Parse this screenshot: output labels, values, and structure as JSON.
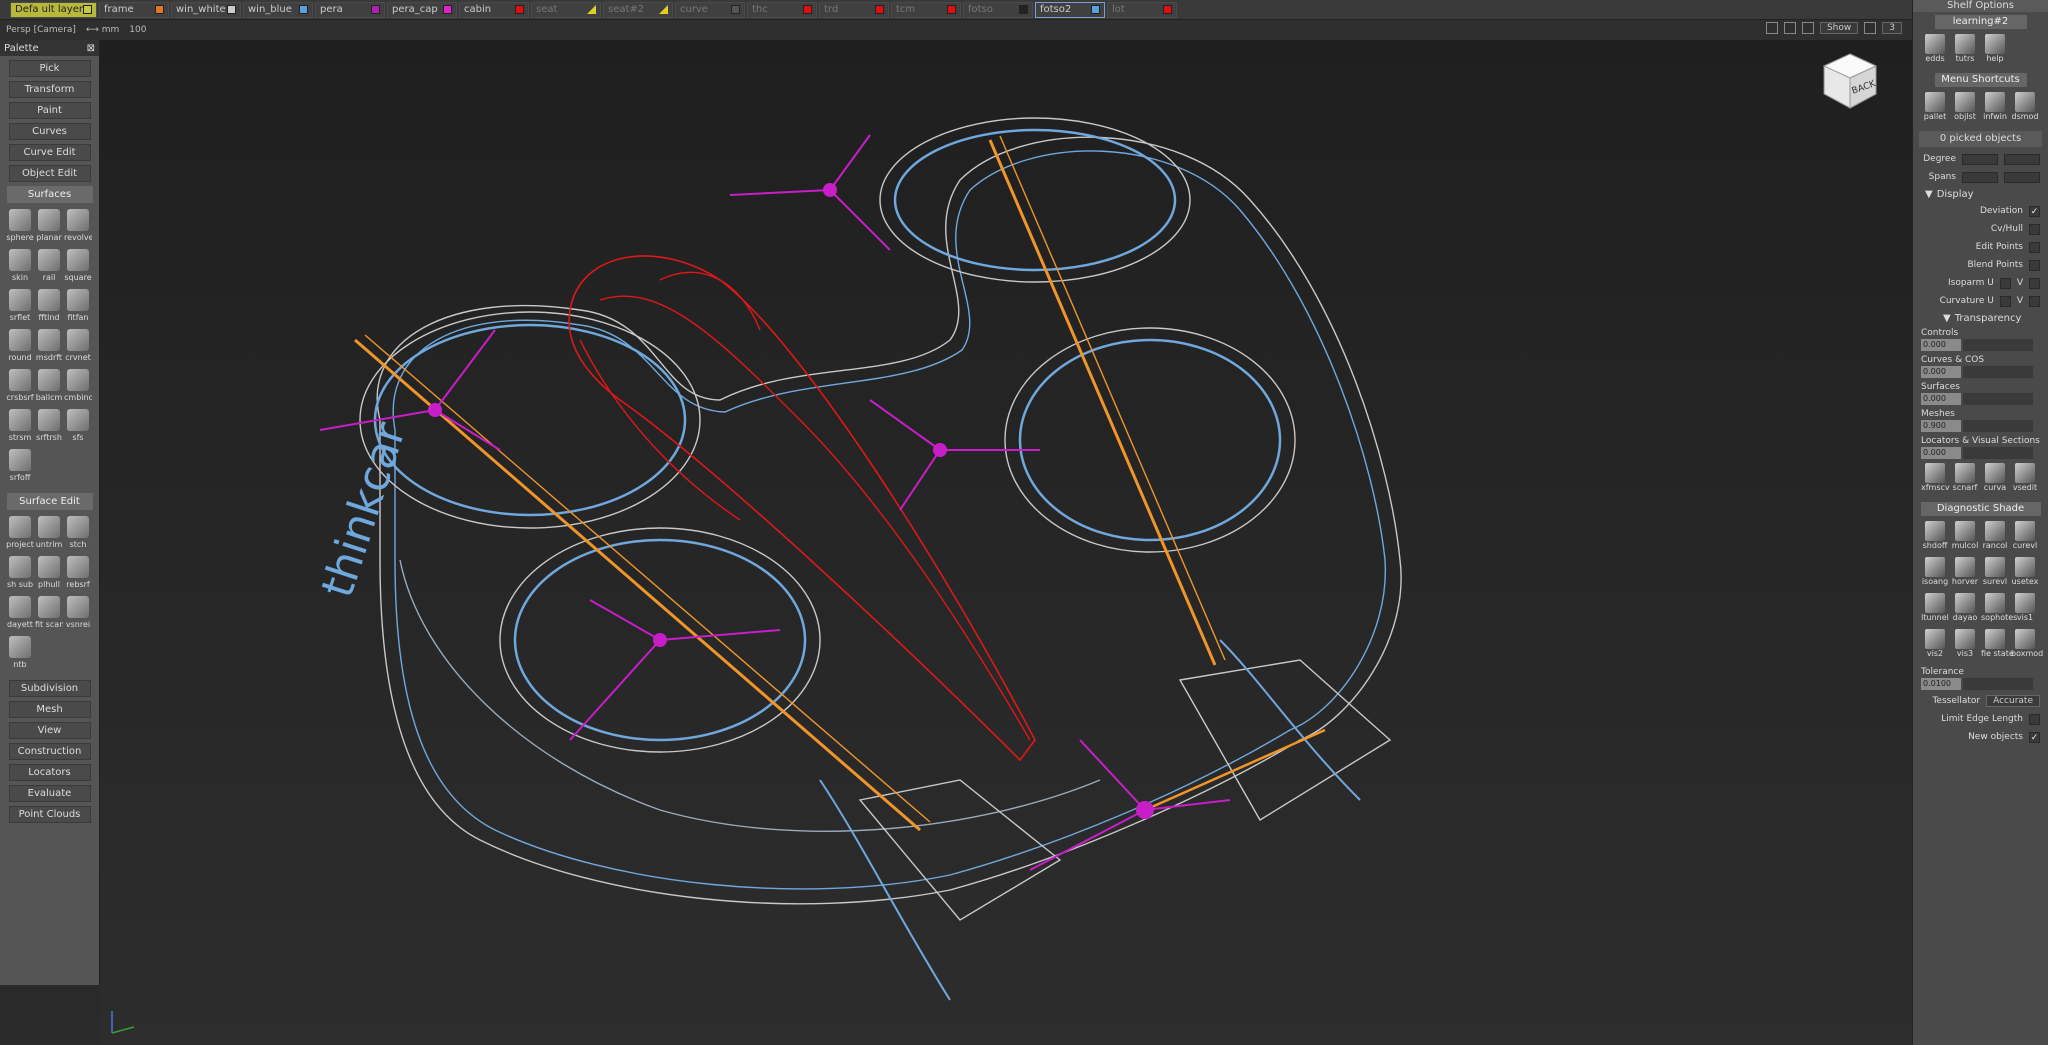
{
  "layers_bar": {
    "layers": [
      {
        "name": "Defa ult layer",
        "color": "#c8c840",
        "state": "active"
      },
      {
        "name": "frame",
        "color": "#e07820",
        "state": "normal"
      },
      {
        "name": "win_white",
        "color": "#cccccc",
        "state": "normal"
      },
      {
        "name": "win_blue",
        "color": "#5aa0e0",
        "state": "normal"
      },
      {
        "name": "pera",
        "color": "#b020b0",
        "state": "normal"
      },
      {
        "name": "pera_cap",
        "color": "#e020c8",
        "state": "normal"
      },
      {
        "name": "cabin",
        "color": "#e01010",
        "state": "normal"
      },
      {
        "name": "seat",
        "color": "#e0d020",
        "state": "hidden"
      },
      {
        "name": "seat#2",
        "color": "#e0d020",
        "state": "hidden"
      },
      {
        "name": "curve",
        "color": "#555555",
        "state": "hidden"
      },
      {
        "name": "thc",
        "color": "#e01010",
        "state": "hidden"
      },
      {
        "name": "trd",
        "color": "#e01010",
        "state": "hidden"
      },
      {
        "name": "tcm",
        "color": "#e01010",
        "state": "hidden"
      },
      {
        "name": "fotso",
        "color": "#222222",
        "state": "hidden"
      },
      {
        "name": "fotso2",
        "color": "#5aa0e0",
        "state": "selected"
      },
      {
        "name": "lot",
        "color": "#e01010",
        "state": "hidden"
      }
    ]
  },
  "viewbar": {
    "camera": "Persp [Camera]",
    "lens": "⟷ mm",
    "zoom": "100",
    "show_label": "Show",
    "number": "3"
  },
  "palette": {
    "title": "Palette",
    "menu_buttons": [
      "Pick",
      "Transform",
      "Paint",
      "Curves",
      "Curve Edit",
      "Object Edit"
    ],
    "surfaces_title": "Surfaces",
    "surfaces_tools": [
      "sphere",
      "planar",
      "revolve",
      "skin",
      "rail",
      "square",
      "srflet",
      "fftlnd",
      "fitfan",
      "round",
      "msdrft",
      "crvnet",
      "crsbsrf",
      "ballcm",
      "cmbind",
      "strsm",
      "srftrsh",
      "sfs",
      "srfoff"
    ],
    "surface_edit_title": "Surface Edit",
    "surface_edit_tools": [
      "project",
      "untrim",
      "stch",
      "sh sub",
      "plhull",
      "rebsrf",
      "dayett",
      "fit scan",
      "vsnrei",
      "ntb"
    ],
    "bottom_buttons": [
      "Subdivision",
      "Mesh",
      "View",
      "Construction",
      "Locators",
      "Evaluate",
      "Point Clouds"
    ]
  },
  "shelf": {
    "title": "Shelf Options",
    "tab": "learning#2",
    "row1": [
      "edds",
      "tutrs",
      "help"
    ],
    "menu_shortcuts_title": "Menu Shortcuts",
    "row2": [
      "pallet",
      "objlst",
      "infwin",
      "dsmod"
    ],
    "picked": "0 picked objects",
    "degree_label": "Degree",
    "spans_label": "Spans",
    "display_title": "Display",
    "display_options": [
      {
        "label": "Deviation",
        "checked": true
      },
      {
        "label": "Cv/Hull",
        "checked": false
      },
      {
        "label": "Edit Points",
        "checked": false
      },
      {
        "label": "Blend Points",
        "checked": false
      },
      {
        "label": "Isoparm U",
        "checked": false,
        "extra": "V"
      },
      {
        "label": "Curvature U",
        "checked": false,
        "extra": "V"
      }
    ],
    "transparency_title": "Transparency",
    "transparency": [
      {
        "label": "Controls",
        "value": "0.000"
      },
      {
        "label": "Curves & COS",
        "value": "0.000"
      },
      {
        "label": "Surfaces",
        "value": "0.000"
      },
      {
        "label": "Meshes",
        "value": "0.900"
      },
      {
        "label": "Locators & Visual Sections",
        "value": "0.000"
      }
    ],
    "row3": [
      "xfmscv",
      "scnarf",
      "curva",
      "vsedit"
    ],
    "diag_title": "Diagnostic Shade",
    "diag_tools": [
      "shdoff",
      "mulcol",
      "rancol",
      "curevl",
      "isoang",
      "horver",
      "surevl",
      "usetex",
      "ltunnel",
      "dayao",
      "sophotes",
      "vis1",
      "vis2",
      "vis3",
      "fie state",
      "boxmod"
    ],
    "tolerance_label": "Tolerance",
    "tolerance_value": "0.0100",
    "tessellator_label": "Tessellator",
    "tessellator_value": "Accurate",
    "limit_edge_label": "Limit Edge Length",
    "new_objects_label": "New objects",
    "new_objects_checked": true
  },
  "viewport": {
    "navcube_label": "BACK",
    "body_text": "thinkcar"
  }
}
